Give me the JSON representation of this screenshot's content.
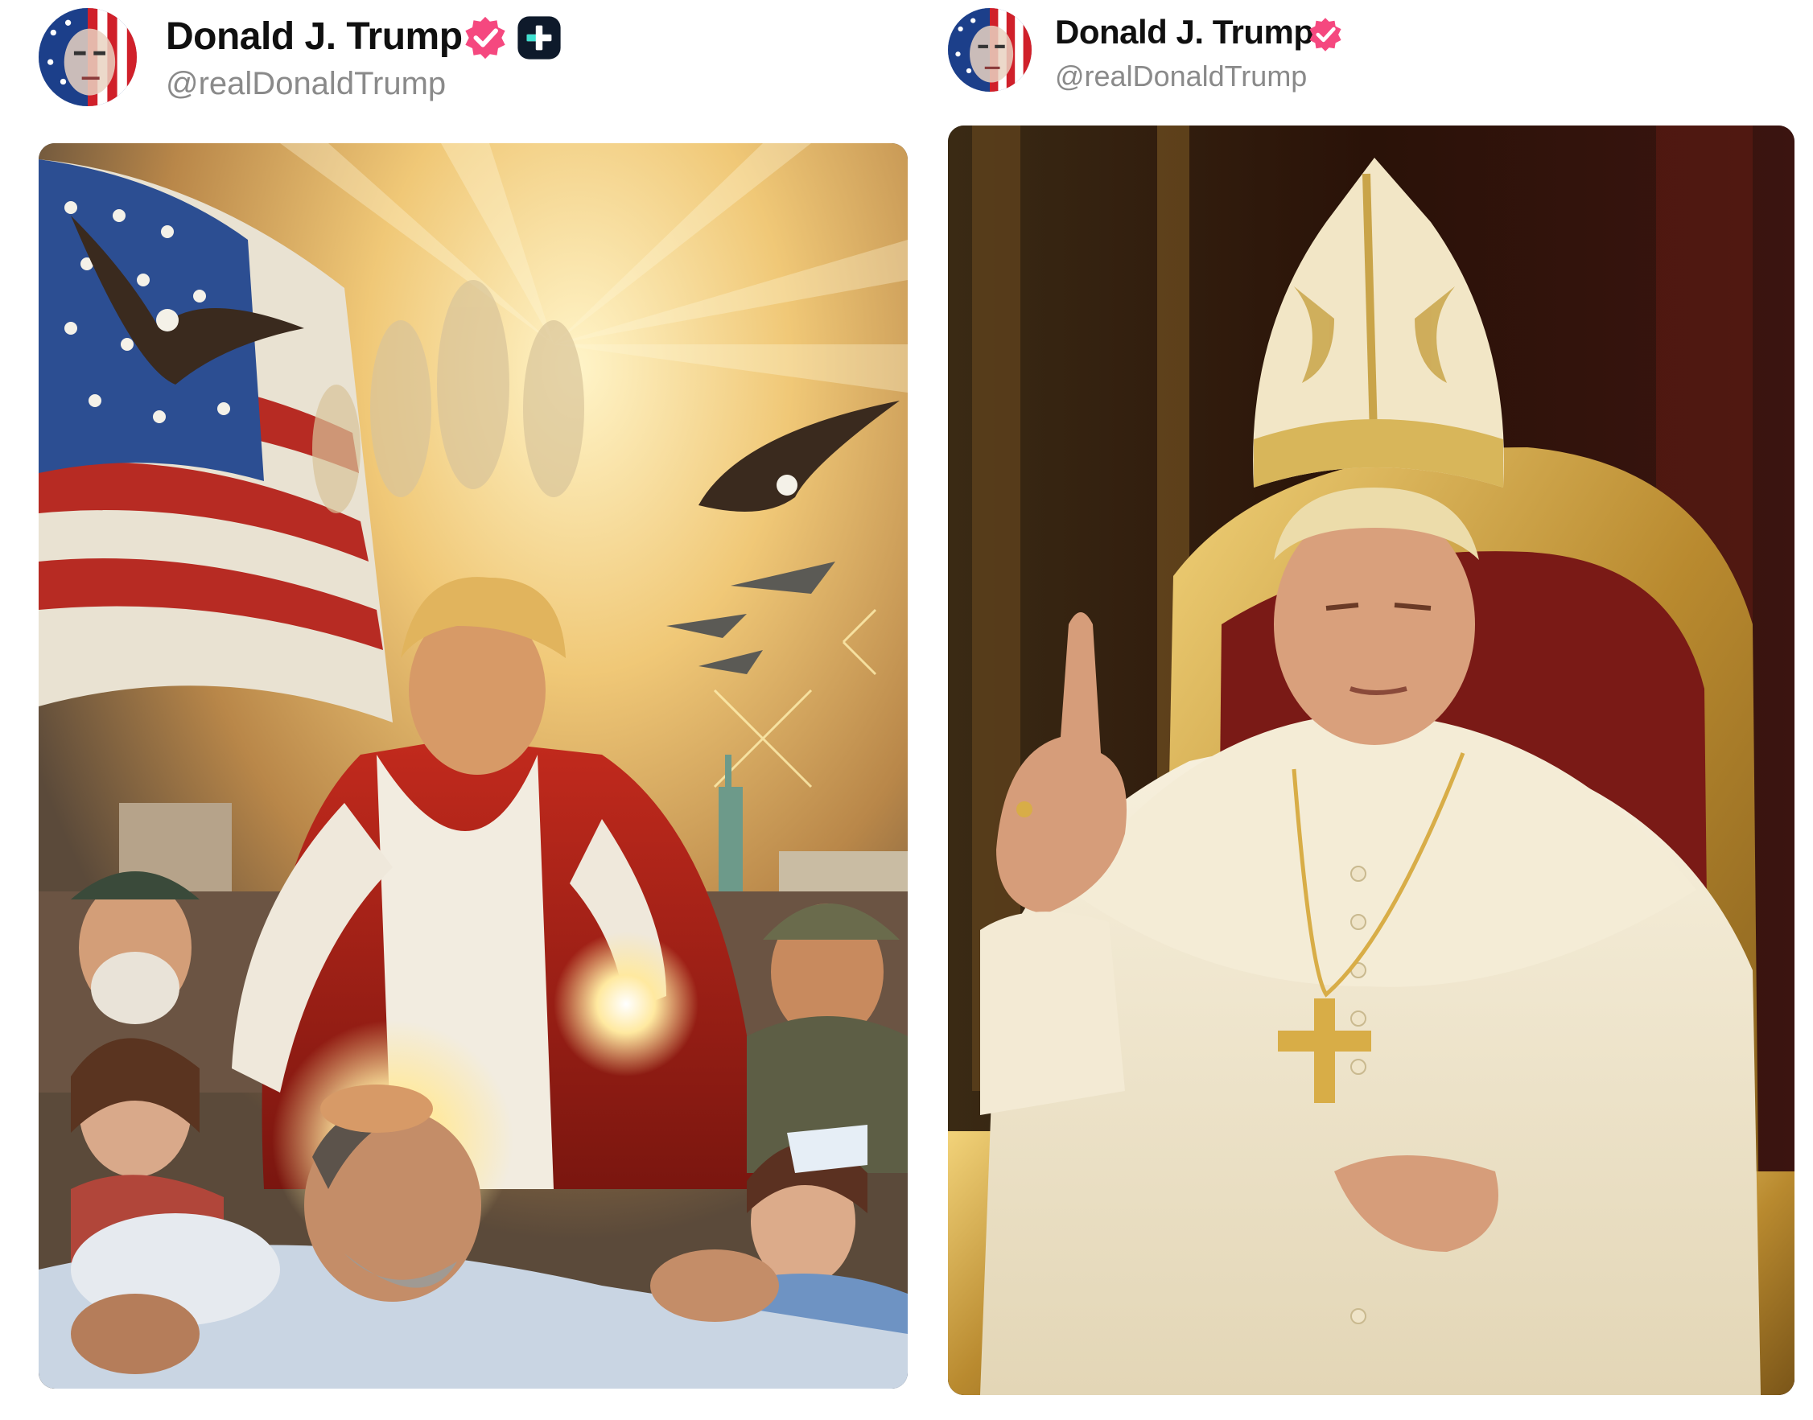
{
  "posts": [
    {
      "author": {
        "display_name": "Donald J. Trump",
        "handle": "@realDonaldTrump",
        "verified_badge_icon": "verified-badge-icon",
        "extra_badge_icon": "plus-badge-icon"
      },
      "media": {
        "type": "image",
        "description_icon": "painting-healer-image"
      }
    },
    {
      "author": {
        "display_name": "Donald J. Trump",
        "handle": "@realDonaldTrump",
        "verified_badge_icon": "verified-badge-icon"
      },
      "media": {
        "type": "image",
        "description_icon": "portrait-papal-image"
      }
    }
  ],
  "colors": {
    "verified_pink": "#f5487f",
    "plus_badge_bg": "#0e1a2b",
    "plus_badge_teal": "#3fe0d0",
    "handle_gray": "#8a8a8a",
    "name_black": "#101010"
  }
}
